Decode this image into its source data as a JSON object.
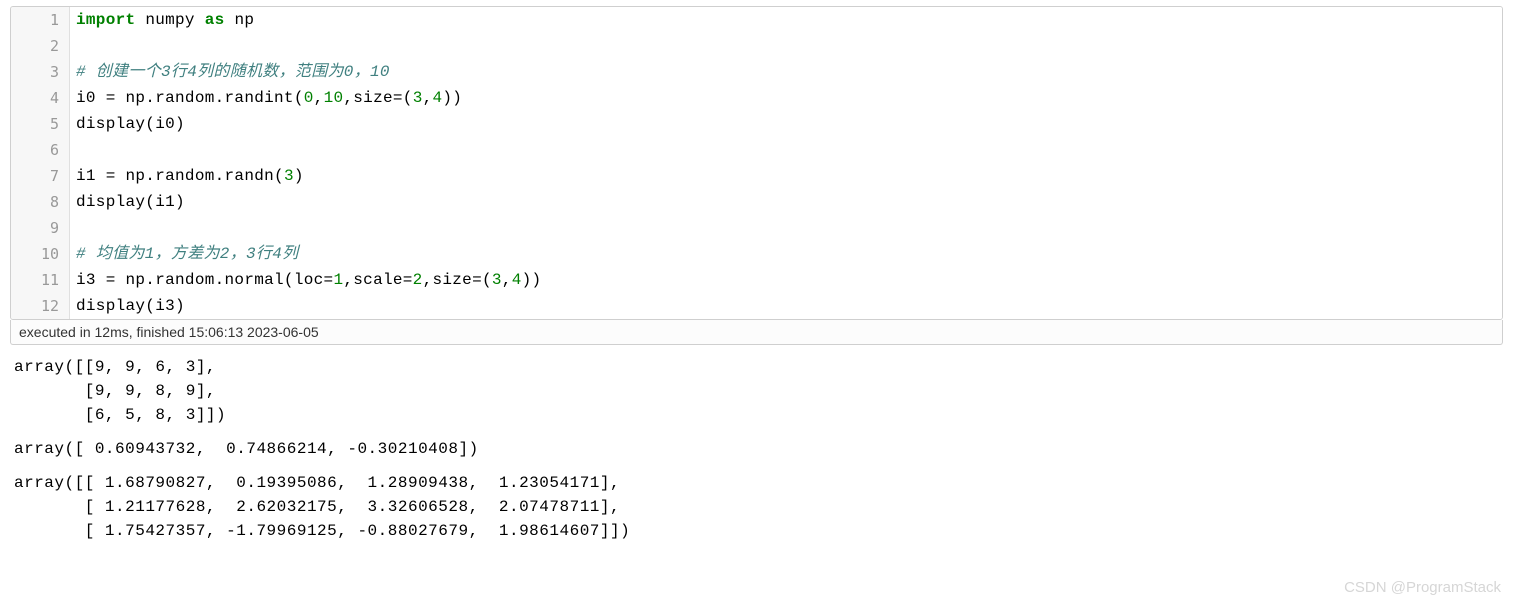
{
  "code": {
    "lines": [
      {
        "n": "1",
        "html": "<span class='kw-green'>import</span> numpy <span class='kw-green'>as</span> np"
      },
      {
        "n": "2",
        "html": ""
      },
      {
        "n": "3",
        "html": "<span class='comment'># 创建一个3行4列的随机数，范围为0，10</span>"
      },
      {
        "n": "4",
        "html": "i0 = np.random.randint(<span class='num'>0</span>,<span class='num'>10</span>,size=(<span class='num'>3</span>,<span class='num'>4</span>))"
      },
      {
        "n": "5",
        "html": "display(i0)"
      },
      {
        "n": "6",
        "html": ""
      },
      {
        "n": "7",
        "html": "i1 = np.random.randn(<span class='num'>3</span>)"
      },
      {
        "n": "8",
        "html": "display(i1)"
      },
      {
        "n": "9",
        "html": ""
      },
      {
        "n": "10",
        "html": "<span class='comment'># 均值为1，方差为2，3行4列</span>"
      },
      {
        "n": "11",
        "html": "i3 = np.random.normal(loc=<span class='num'>1</span>,scale=<span class='num'>2</span>,size=(<span class='num'>3</span>,<span class='num'>4</span>))"
      },
      {
        "n": "12",
        "html": "display(i3)"
      }
    ]
  },
  "exec_status": "executed in 12ms, finished 15:06:13 2023-06-05",
  "output": {
    "block1": "array([[9, 9, 6, 3],\n       [9, 9, 8, 9],\n       [6, 5, 8, 3]])",
    "block2": "array([ 0.60943732,  0.74866214, -0.30210408])",
    "block3": "array([[ 1.68790827,  0.19395086,  1.28909438,  1.23054171],\n       [ 1.21177628,  2.62032175,  3.32606528,  2.07478711],\n       [ 1.75427357, -1.79969125, -0.88027679,  1.98614607]])"
  },
  "watermark": "CSDN @ProgramStack"
}
